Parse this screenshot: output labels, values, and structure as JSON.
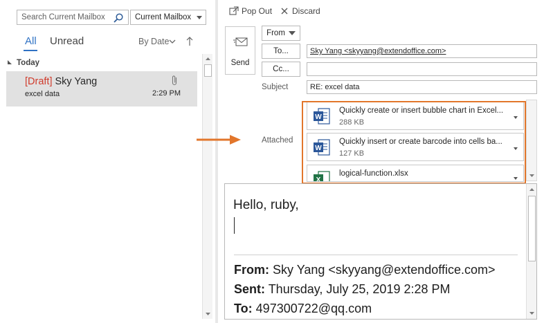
{
  "search": {
    "placeholder": "Search Current Mailbox",
    "scope": "Current Mailbox"
  },
  "filters": {
    "all": "All",
    "unread": "Unread",
    "sort": "By Date"
  },
  "list": {
    "group": "Today",
    "items": [
      {
        "draft_tag": "[Draft]",
        "sender": "Sky Yang",
        "subject": "excel data",
        "time": "2:29 PM",
        "has_attachment": true
      }
    ]
  },
  "toolbar": {
    "popout": "Pop Out",
    "discard": "Discard"
  },
  "compose": {
    "send_label": "Send",
    "from_label": "From",
    "to_label": "To...",
    "cc_label": "Cc...",
    "to_value": "Sky Yang <skyyang@extendoffice.com>",
    "cc_value": "",
    "subject_label": "Subject",
    "subject_value": "RE: excel data",
    "attached_label": "Attached",
    "attachments": [
      {
        "name": "Quickly create or insert bubble chart in Excel...",
        "size": "288 KB",
        "type": "word-doc-icon"
      },
      {
        "name": "Quickly insert or create barcode into cells ba...",
        "size": "127 KB",
        "type": "word-doc-icon"
      },
      {
        "name": "logical-function.xlsx",
        "size": "",
        "type": "excel-file-icon"
      }
    ]
  },
  "body": {
    "greeting": "Hello, ruby,",
    "from_label": "From:",
    "from_value": "Sky Yang <skyyang@extendoffice.com>",
    "sent_label": "Sent:",
    "sent_value": "Thursday, July 25, 2019 2:28 PM",
    "to_label": "To:",
    "to_value": "497300722@qq.com"
  },
  "colors": {
    "accent": "#2f72c4",
    "draft": "#d03b2c",
    "highlight": "#e2762b",
    "selected": "#e1e1e1"
  }
}
